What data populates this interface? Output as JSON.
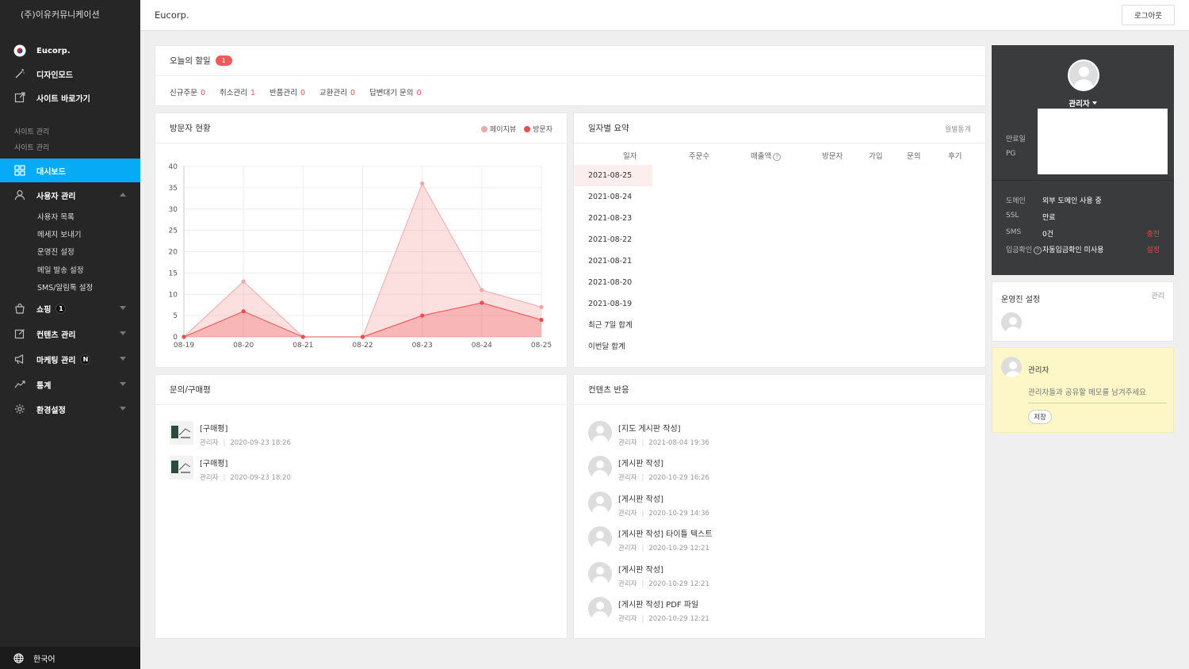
{
  "sidebar": {
    "company": "(주)이유커뮤니케이션",
    "sites": [
      {
        "label": "Eucorp.",
        "icon": "korea-flag-icon"
      },
      {
        "label": "디자인모드",
        "icon": "magic-wand-icon"
      },
      {
        "label": "사이트 바로가기",
        "icon": "external-link-icon"
      }
    ],
    "site_admin_1": "사이트 관리",
    "site_admin_2": "사이트 관리",
    "menu": [
      {
        "label": "대시보드",
        "icon": "dashboard-icon",
        "active": true
      },
      {
        "label": "사용자 관리",
        "icon": "user-icon",
        "expanded": true
      },
      {
        "label": "쇼핑",
        "icon": "shopping-bag-icon",
        "badge": "1"
      },
      {
        "label": "컨텐츠 관리",
        "icon": "edit-icon"
      },
      {
        "label": "마케팅 관리",
        "icon": "megaphone-icon",
        "badge": "N"
      },
      {
        "label": "통계",
        "icon": "trend-icon"
      },
      {
        "label": "환경설정",
        "icon": "gear-icon"
      }
    ],
    "user_submenu": [
      "사용자 목록",
      "메세지 보내기",
      "운영진 설정",
      "메일 발송 설정",
      "SMS/알림톡 설정"
    ],
    "language": "한국어"
  },
  "header": {
    "title": "Eucorp.",
    "logout": "로그아웃"
  },
  "todo": {
    "title": "오늘의 할일",
    "badge": "1",
    "items": [
      {
        "label": "신규주문",
        "count": "0"
      },
      {
        "label": "취소관리",
        "count": "1"
      },
      {
        "label": "반품관리",
        "count": "0"
      },
      {
        "label": "교환관리",
        "count": "0"
      },
      {
        "label": "답변대기 문의",
        "count": "0"
      }
    ]
  },
  "visitors": {
    "title": "방문자 현황",
    "legend": [
      {
        "label": "페이지뷰",
        "color": "#f6a5a5"
      },
      {
        "label": "방문자",
        "color": "#ee4d4d"
      }
    ]
  },
  "chart_data": {
    "type": "area",
    "x": [
      "08-19",
      "08-20",
      "08-21",
      "08-22",
      "08-23",
      "08-24",
      "08-25"
    ],
    "ylim": [
      0,
      40
    ],
    "yticks": [
      0,
      5,
      10,
      15,
      20,
      25,
      30,
      35,
      40
    ],
    "grid": true,
    "legend_position": "top-right",
    "series": [
      {
        "name": "페이지뷰",
        "values": [
          0,
          13,
          0,
          0,
          36,
          11,
          7
        ],
        "color": "#f6a5a5"
      },
      {
        "name": "방문자",
        "values": [
          0,
          6,
          0,
          0,
          5,
          8,
          4
        ],
        "color": "#ee4d4d"
      }
    ]
  },
  "summary": {
    "title": "일자별 요약",
    "link": "월별통계",
    "columns": [
      "일자",
      "주문수",
      "매출액",
      "방문자",
      "가입",
      "문의",
      "후기"
    ],
    "help": "?",
    "rows": [
      "2021-08-25",
      "2021-08-24",
      "2021-08-23",
      "2021-08-22",
      "2021-08-21",
      "2021-08-20",
      "2021-08-19",
      "최근 7일 합계",
      "이번달 합계"
    ]
  },
  "reviews": {
    "title": "문의/구매평",
    "items": [
      {
        "title": "[구매평]",
        "author": "관리자",
        "date": "2020-09-23 18:26"
      },
      {
        "title": "[구매평]",
        "author": "관리자",
        "date": "2020-09-23 18:20"
      }
    ]
  },
  "content": {
    "title": "컨텐츠 반응",
    "items": [
      {
        "title": "[지도 게시판 작성]",
        "author": "관리자",
        "date": "2021-08-04 19:36"
      },
      {
        "title": "[게시판 작성]",
        "author": "관리자",
        "date": "2020-10-29 16:26"
      },
      {
        "title": "[게시판 작성]",
        "author": "관리자",
        "date": "2020-10-29 14:36"
      },
      {
        "title": "[게시판 작성] 타이틀 텍스트",
        "author": "관리자",
        "date": "2020-10-29 12:21"
      },
      {
        "title": "[게시판 작성]",
        "author": "관리자",
        "date": "2020-10-29 12:21"
      },
      {
        "title": "[게시판 작성] PDF 파일",
        "author": "관리자",
        "date": "2020-10-29 12:21"
      }
    ]
  },
  "info": {
    "name": "관리자",
    "expire_label": "만료일",
    "pg_label": "PG",
    "rows": [
      {
        "label": "도메인",
        "value": "외부 도메인 사용 중",
        "action": ""
      },
      {
        "label": "SSL",
        "value": "만료",
        "action": ""
      },
      {
        "label": "SMS",
        "value": "0건",
        "action": "충전"
      },
      {
        "label": "입금확인",
        "value": "자동입금확인 미사용",
        "action": "설정"
      }
    ]
  },
  "admins": {
    "title": "운영진 설정",
    "link": "관리"
  },
  "memo": {
    "name": "관리자",
    "placeholder": "관리자들과 공유할 메모를 남겨주세요",
    "save": "저장"
  }
}
